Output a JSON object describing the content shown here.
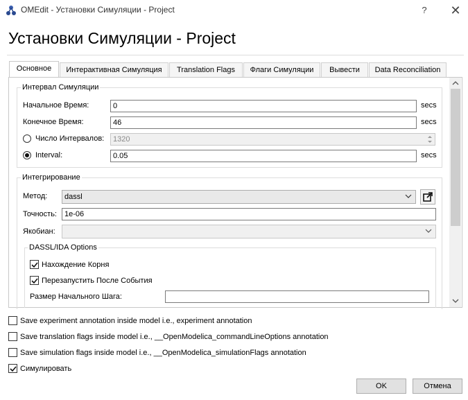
{
  "window": {
    "title": "OMEdit - Установки Симуляции - Project",
    "help_label": "?",
    "close_label": "✕"
  },
  "heading": "Установки Симуляции - Project",
  "tabs": [
    {
      "label": "Основное",
      "active": true
    },
    {
      "label": "Интерактивная Симуляция"
    },
    {
      "label": "Translation Flags"
    },
    {
      "label": "Флаги Симуляции"
    },
    {
      "label": "Вывести"
    },
    {
      "label": "Data Reconciliation"
    }
  ],
  "interval": {
    "title": "Интервал Симуляции",
    "start_label": "Начальное Время:",
    "start_value": "0",
    "start_unit": "secs",
    "stop_label": "Конечное Время:",
    "stop_value": "46",
    "stop_unit": "secs",
    "intervals_label": "Число Интервалов:",
    "intervals_value": "1320",
    "interval_label": "Interval:",
    "interval_value": "0.05",
    "interval_unit": "secs"
  },
  "integration": {
    "title": "Интегрирование",
    "method_label": "Метод:",
    "method_value": "dassl",
    "tolerance_label": "Точность:",
    "tolerance_value": "1e-06",
    "jacobian_label": "Якобиан:",
    "jacobian_value": "",
    "dassl": {
      "title": "DASSL/IDA Options",
      "root_finding_label": "Нахождение Корня",
      "root_finding_checked": true,
      "restart_label": "Перезапустить После События",
      "restart_checked": true,
      "initial_step_label": "Размер Начального Шага:",
      "initial_step_value": ""
    }
  },
  "options": {
    "save_experiment": "Save experiment annotation inside model i.e., experiment annotation",
    "save_translation": "Save translation flags inside model i.e., __OpenModelica_commandLineOptions annotation",
    "save_simulation": "Save simulation flags inside model i.e., __OpenModelica_simulationFlags annotation",
    "simulate": "Симулировать",
    "simulate_checked": true
  },
  "buttons": {
    "ok": "OK",
    "cancel": "Отмена"
  },
  "colors": {
    "dialog_bg": "#ffffff",
    "tab_border": "#c8c8c8",
    "button_bg": "#e1e1e1"
  }
}
